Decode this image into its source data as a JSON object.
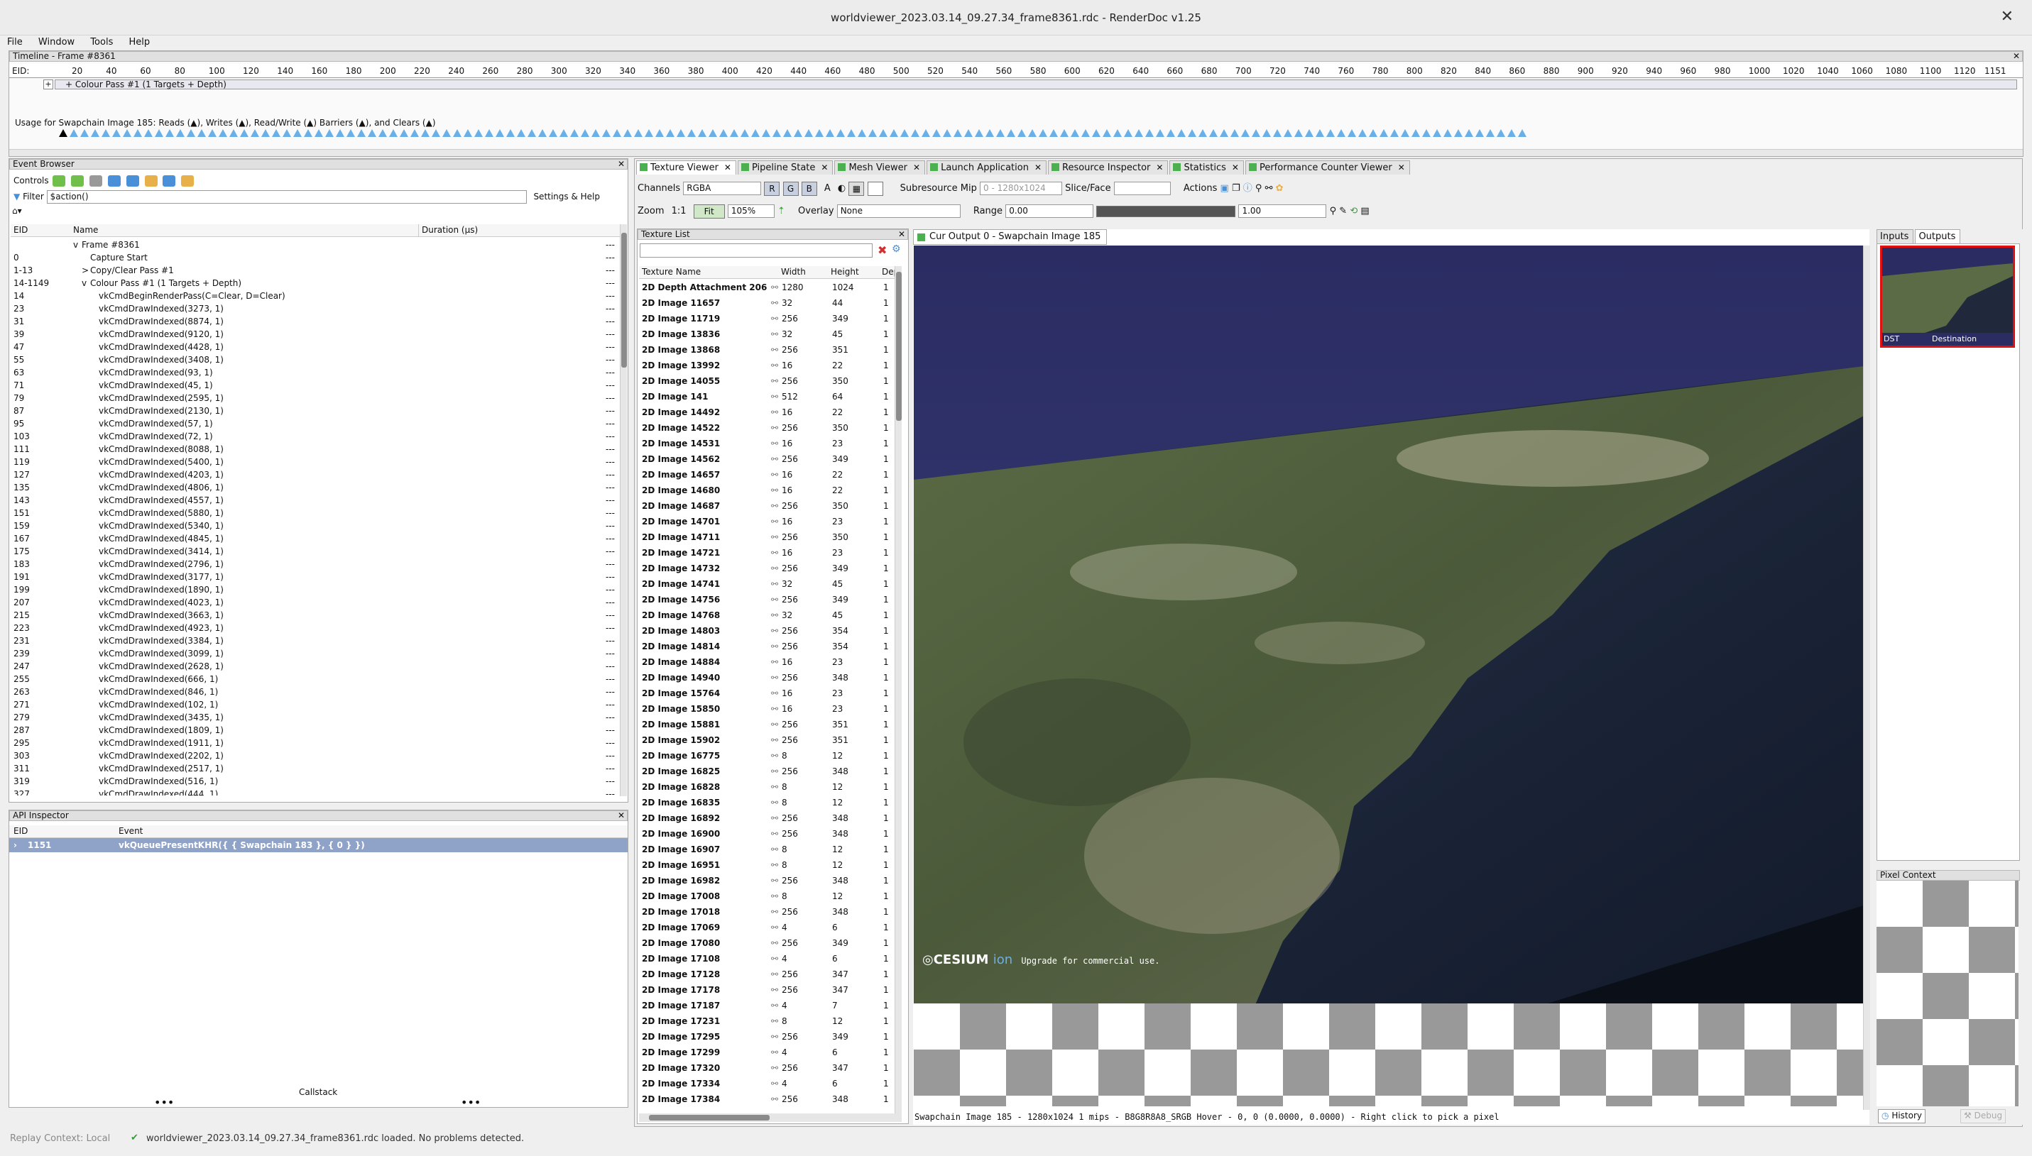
{
  "window": {
    "title": "worldviewer_2023.03.14_09.27.34_frame8361.rdc - RenderDoc v1.25"
  },
  "menu": [
    "File",
    "Window",
    "Tools",
    "Help"
  ],
  "timeline": {
    "title": "Timeline - Frame #8361",
    "eid_label": "EID:",
    "ticks": [
      "20",
      "40",
      "60",
      "80",
      "100",
      "120",
      "140",
      "160",
      "180",
      "200",
      "220",
      "240",
      "260",
      "280",
      "300",
      "320",
      "340",
      "360",
      "380",
      "400",
      "420",
      "440",
      "460",
      "480",
      "500",
      "520",
      "540",
      "560",
      "580",
      "600",
      "620",
      "640",
      "660",
      "680",
      "700",
      "720",
      "740",
      "760",
      "780",
      "800",
      "820",
      "840",
      "860",
      "880",
      "900",
      "920",
      "940",
      "960",
      "980",
      "1000",
      "1020",
      "1040",
      "1060",
      "1080",
      "1100",
      "1120"
    ],
    "end_tick": "1151",
    "pass_label": "+ Colour Pass #1 (1 Targets + Depth)",
    "plus": "+",
    "usage": "Usage for Swapchain Image 185: Reads (▲), Writes (▲), Read/Write (▲) Barriers (▲), and Clears (▲)"
  },
  "event_browser": {
    "title": "Event Browser",
    "controls_label": "Controls",
    "filter_label": "Filter",
    "filter_value": "$action()",
    "settings_label": "Settings & Help",
    "col_eid": "EID",
    "col_name": "Name",
    "col_duration": "Duration (µs)",
    "rows": [
      {
        "eid": "",
        "name": "Frame #8361",
        "dur": "---",
        "indent": 0,
        "exp": "v"
      },
      {
        "eid": "0",
        "name": "Capture Start",
        "dur": "---",
        "indent": 1,
        "exp": ""
      },
      {
        "eid": "1-13",
        "name": "Copy/Clear Pass #1",
        "dur": "---",
        "indent": 1,
        "exp": ">"
      },
      {
        "eid": "14-1149",
        "name": "Colour Pass #1 (1 Targets + Depth)",
        "dur": "---",
        "indent": 1,
        "exp": "v"
      },
      {
        "eid": "14",
        "name": "vkCmdBeginRenderPass(C=Clear, D=Clear)",
        "dur": "---",
        "indent": 2,
        "exp": ""
      },
      {
        "eid": "23",
        "name": "vkCmdDrawIndexed(3273, 1)",
        "dur": "---",
        "indent": 2,
        "exp": ""
      },
      {
        "eid": "31",
        "name": "vkCmdDrawIndexed(8874, 1)",
        "dur": "---",
        "indent": 2,
        "exp": ""
      },
      {
        "eid": "39",
        "name": "vkCmdDrawIndexed(9120, 1)",
        "dur": "---",
        "indent": 2,
        "exp": ""
      },
      {
        "eid": "47",
        "name": "vkCmdDrawIndexed(4428, 1)",
        "dur": "---",
        "indent": 2,
        "exp": ""
      },
      {
        "eid": "55",
        "name": "vkCmdDrawIndexed(3408, 1)",
        "dur": "---",
        "indent": 2,
        "exp": ""
      },
      {
        "eid": "63",
        "name": "vkCmdDrawIndexed(93, 1)",
        "dur": "---",
        "indent": 2,
        "exp": ""
      },
      {
        "eid": "71",
        "name": "vkCmdDrawIndexed(45, 1)",
        "dur": "---",
        "indent": 2,
        "exp": ""
      },
      {
        "eid": "79",
        "name": "vkCmdDrawIndexed(2595, 1)",
        "dur": "---",
        "indent": 2,
        "exp": ""
      },
      {
        "eid": "87",
        "name": "vkCmdDrawIndexed(2130, 1)",
        "dur": "---",
        "indent": 2,
        "exp": ""
      },
      {
        "eid": "95",
        "name": "vkCmdDrawIndexed(57, 1)",
        "dur": "---",
        "indent": 2,
        "exp": ""
      },
      {
        "eid": "103",
        "name": "vkCmdDrawIndexed(72, 1)",
        "dur": "---",
        "indent": 2,
        "exp": ""
      },
      {
        "eid": "111",
        "name": "vkCmdDrawIndexed(8088, 1)",
        "dur": "---",
        "indent": 2,
        "exp": ""
      },
      {
        "eid": "119",
        "name": "vkCmdDrawIndexed(5400, 1)",
        "dur": "---",
        "indent": 2,
        "exp": ""
      },
      {
        "eid": "127",
        "name": "vkCmdDrawIndexed(4203, 1)",
        "dur": "---",
        "indent": 2,
        "exp": ""
      },
      {
        "eid": "135",
        "name": "vkCmdDrawIndexed(4806, 1)",
        "dur": "---",
        "indent": 2,
        "exp": ""
      },
      {
        "eid": "143",
        "name": "vkCmdDrawIndexed(4557, 1)",
        "dur": "---",
        "indent": 2,
        "exp": ""
      },
      {
        "eid": "151",
        "name": "vkCmdDrawIndexed(5880, 1)",
        "dur": "---",
        "indent": 2,
        "exp": ""
      },
      {
        "eid": "159",
        "name": "vkCmdDrawIndexed(5340, 1)",
        "dur": "---",
        "indent": 2,
        "exp": ""
      },
      {
        "eid": "167",
        "name": "vkCmdDrawIndexed(4845, 1)",
        "dur": "---",
        "indent": 2,
        "exp": ""
      },
      {
        "eid": "175",
        "name": "vkCmdDrawIndexed(3414, 1)",
        "dur": "---",
        "indent": 2,
        "exp": ""
      },
      {
        "eid": "183",
        "name": "vkCmdDrawIndexed(2796, 1)",
        "dur": "---",
        "indent": 2,
        "exp": ""
      },
      {
        "eid": "191",
        "name": "vkCmdDrawIndexed(3177, 1)",
        "dur": "---",
        "indent": 2,
        "exp": ""
      },
      {
        "eid": "199",
        "name": "vkCmdDrawIndexed(1890, 1)",
        "dur": "---",
        "indent": 2,
        "exp": ""
      },
      {
        "eid": "207",
        "name": "vkCmdDrawIndexed(4023, 1)",
        "dur": "---",
        "indent": 2,
        "exp": ""
      },
      {
        "eid": "215",
        "name": "vkCmdDrawIndexed(3663, 1)",
        "dur": "---",
        "indent": 2,
        "exp": ""
      },
      {
        "eid": "223",
        "name": "vkCmdDrawIndexed(4923, 1)",
        "dur": "---",
        "indent": 2,
        "exp": ""
      },
      {
        "eid": "231",
        "name": "vkCmdDrawIndexed(3384, 1)",
        "dur": "---",
        "indent": 2,
        "exp": ""
      },
      {
        "eid": "239",
        "name": "vkCmdDrawIndexed(3099, 1)",
        "dur": "---",
        "indent": 2,
        "exp": ""
      },
      {
        "eid": "247",
        "name": "vkCmdDrawIndexed(2628, 1)",
        "dur": "---",
        "indent": 2,
        "exp": ""
      },
      {
        "eid": "255",
        "name": "vkCmdDrawIndexed(666, 1)",
        "dur": "---",
        "indent": 2,
        "exp": ""
      },
      {
        "eid": "263",
        "name": "vkCmdDrawIndexed(846, 1)",
        "dur": "---",
        "indent": 2,
        "exp": ""
      },
      {
        "eid": "271",
        "name": "vkCmdDrawIndexed(102, 1)",
        "dur": "---",
        "indent": 2,
        "exp": ""
      },
      {
        "eid": "279",
        "name": "vkCmdDrawIndexed(3435, 1)",
        "dur": "---",
        "indent": 2,
        "exp": ""
      },
      {
        "eid": "287",
        "name": "vkCmdDrawIndexed(1809, 1)",
        "dur": "---",
        "indent": 2,
        "exp": ""
      },
      {
        "eid": "295",
        "name": "vkCmdDrawIndexed(1911, 1)",
        "dur": "---",
        "indent": 2,
        "exp": ""
      },
      {
        "eid": "303",
        "name": "vkCmdDrawIndexed(2202, 1)",
        "dur": "---",
        "indent": 2,
        "exp": ""
      },
      {
        "eid": "311",
        "name": "vkCmdDrawIndexed(2517, 1)",
        "dur": "---",
        "indent": 2,
        "exp": ""
      },
      {
        "eid": "319",
        "name": "vkCmdDrawIndexed(516, 1)",
        "dur": "---",
        "indent": 2,
        "exp": ""
      },
      {
        "eid": "327",
        "name": "vkCmdDrawIndexed(444, 1)",
        "dur": "---",
        "indent": 2,
        "exp": ""
      }
    ]
  },
  "api_inspector": {
    "title": "API Inspector",
    "col_eid": "EID",
    "col_event": "Event",
    "row_eid": "1151",
    "row_event": "vkQueuePresentKHR({ { Swapchain 183 }, { 0 } })",
    "callstack": "Callstack",
    "dots": "•••"
  },
  "status": {
    "context": "Replay Context: Local",
    "message": "worldviewer_2023.03.14_09.27.34_frame8361.rdc loaded. No problems detected."
  },
  "tabs": [
    "Texture Viewer",
    "Pipeline State",
    "Mesh Viewer",
    "Launch Application",
    "Resource Inspector",
    "Statistics",
    "Performance Counter Viewer"
  ],
  "toolbar": {
    "channels_label": "Channels",
    "channels_value": "RGBA",
    "r": "R",
    "g": "G",
    "b": "B",
    "a": "A",
    "subresource": "Subresource",
    "mip_label": "Mip",
    "mip_value": "0 - 1280x1024",
    "slice_label": "Slice/Face",
    "actions_label": "Actions",
    "zoom_label": "Zoom",
    "zoom_11": "1:1",
    "fit": "Fit",
    "zoom_value": "105%",
    "overlay_label": "Overlay",
    "overlay_value": "None",
    "range_label": "Range",
    "range_min": "0.00",
    "range_max": "1.00"
  },
  "texture_list": {
    "title": "Texture List",
    "col_name": "Texture Name",
    "col_width": "Width",
    "col_height": "Height",
    "col_depth": "Dep",
    "rows": [
      [
        "2D Depth Attachment 206",
        "1280",
        "1024",
        "1"
      ],
      [
        "2D Image 11657",
        "32",
        "44",
        "1"
      ],
      [
        "2D Image 11719",
        "256",
        "349",
        "1"
      ],
      [
        "2D Image 13836",
        "32",
        "45",
        "1"
      ],
      [
        "2D Image 13868",
        "256",
        "351",
        "1"
      ],
      [
        "2D Image 13992",
        "16",
        "22",
        "1"
      ],
      [
        "2D Image 14055",
        "256",
        "350",
        "1"
      ],
      [
        "2D Image 141",
        "512",
        "64",
        "1"
      ],
      [
        "2D Image 14492",
        "16",
        "22",
        "1"
      ],
      [
        "2D Image 14522",
        "256",
        "350",
        "1"
      ],
      [
        "2D Image 14531",
        "16",
        "23",
        "1"
      ],
      [
        "2D Image 14562",
        "256",
        "349",
        "1"
      ],
      [
        "2D Image 14657",
        "16",
        "22",
        "1"
      ],
      [
        "2D Image 14680",
        "16",
        "22",
        "1"
      ],
      [
        "2D Image 14687",
        "256",
        "350",
        "1"
      ],
      [
        "2D Image 14701",
        "16",
        "23",
        "1"
      ],
      [
        "2D Image 14711",
        "256",
        "350",
        "1"
      ],
      [
        "2D Image 14721",
        "16",
        "23",
        "1"
      ],
      [
        "2D Image 14732",
        "256",
        "349",
        "1"
      ],
      [
        "2D Image 14741",
        "32",
        "45",
        "1"
      ],
      [
        "2D Image 14756",
        "256",
        "349",
        "1"
      ],
      [
        "2D Image 14768",
        "32",
        "45",
        "1"
      ],
      [
        "2D Image 14803",
        "256",
        "354",
        "1"
      ],
      [
        "2D Image 14814",
        "256",
        "354",
        "1"
      ],
      [
        "2D Image 14884",
        "16",
        "23",
        "1"
      ],
      [
        "2D Image 14940",
        "256",
        "348",
        "1"
      ],
      [
        "2D Image 15764",
        "16",
        "23",
        "1"
      ],
      [
        "2D Image 15850",
        "16",
        "23",
        "1"
      ],
      [
        "2D Image 15881",
        "256",
        "351",
        "1"
      ],
      [
        "2D Image 15902",
        "256",
        "351",
        "1"
      ],
      [
        "2D Image 16775",
        "8",
        "12",
        "1"
      ],
      [
        "2D Image 16825",
        "256",
        "348",
        "1"
      ],
      [
        "2D Image 16828",
        "8",
        "12",
        "1"
      ],
      [
        "2D Image 16835",
        "8",
        "12",
        "1"
      ],
      [
        "2D Image 16892",
        "256",
        "348",
        "1"
      ],
      [
        "2D Image 16900",
        "256",
        "348",
        "1"
      ],
      [
        "2D Image 16907",
        "8",
        "12",
        "1"
      ],
      [
        "2D Image 16951",
        "8",
        "12",
        "1"
      ],
      [
        "2D Image 16982",
        "256",
        "348",
        "1"
      ],
      [
        "2D Image 17008",
        "8",
        "12",
        "1"
      ],
      [
        "2D Image 17018",
        "256",
        "348",
        "1"
      ],
      [
        "2D Image 17069",
        "4",
        "6",
        "1"
      ],
      [
        "2D Image 17080",
        "256",
        "349",
        "1"
      ],
      [
        "2D Image 17108",
        "4",
        "6",
        "1"
      ],
      [
        "2D Image 17128",
        "256",
        "347",
        "1"
      ],
      [
        "2D Image 17178",
        "256",
        "347",
        "1"
      ],
      [
        "2D Image 17187",
        "4",
        "7",
        "1"
      ],
      [
        "2D Image 17231",
        "8",
        "12",
        "1"
      ],
      [
        "2D Image 17295",
        "256",
        "349",
        "1"
      ],
      [
        "2D Image 17299",
        "4",
        "6",
        "1"
      ],
      [
        "2D Image 17320",
        "256",
        "347",
        "1"
      ],
      [
        "2D Image 17334",
        "4",
        "6",
        "1"
      ],
      [
        "2D Image 17384",
        "256",
        "348",
        "1"
      ]
    ]
  },
  "viewer": {
    "tab_label": "Cur Output 0 - Swapchain Image 185",
    "watermark_brand": "CESIUM",
    "watermark_ion": "ion",
    "watermark_text": "Upgrade for commercial use.",
    "status": "Swapchain Image 185 - 1280x1024 1 mips - B8G8R8A8_SRGB      Hover -    0,    0 (0.0000, 0.0000) - Right click to pick a pixel"
  },
  "right_panel": {
    "inputs": "Inputs",
    "outputs": "Outputs",
    "thumb_left": "DST",
    "thumb_right": "Destination",
    "pixel_context": "Pixel Context",
    "history": "History",
    "debug": "Debug"
  },
  "colors": {
    "accent": "#6ab0e8",
    "selection": "#8fa3c8",
    "highlight_border": "#e01010"
  }
}
